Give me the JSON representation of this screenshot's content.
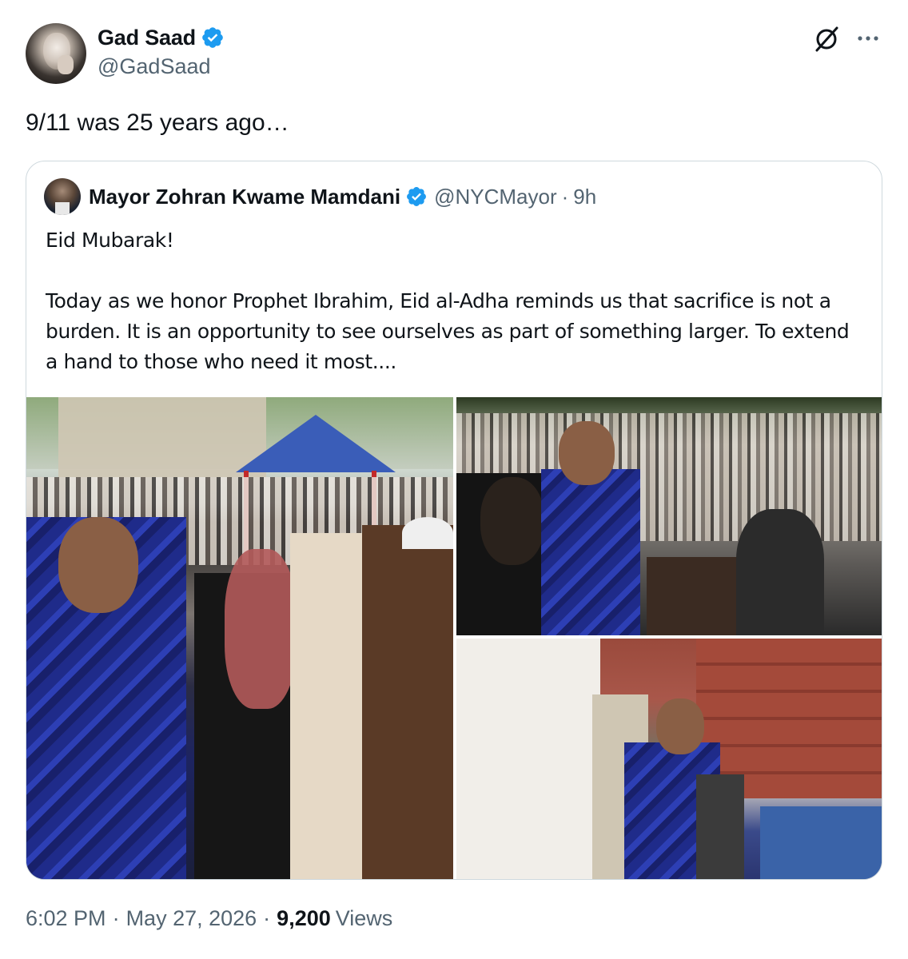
{
  "author": {
    "display_name": "Gad Saad",
    "handle": "@GadSaad",
    "verified_icon": "verified-badge-icon"
  },
  "actions": {
    "grok_icon": "grok-icon",
    "more_icon": "more-options-icon"
  },
  "tweet": {
    "text": "9/11 was 25 years ago…"
  },
  "quote": {
    "display_name": "Mayor Zohran Kwame Mamdani",
    "handle": "@NYCMayor",
    "separator": "·",
    "time": "9h",
    "paragraphs": [
      "Eid Mubarak!",
      "Today as we honor Prophet Ibrahim, Eid al-Adha reminds us that sacrifice is not a burden. It is an opportunity to see ourselves as part of something larger. To extend a hand to those who need it most...."
    ]
  },
  "footer": {
    "time": "6:02 PM",
    "separator": "·",
    "date": "May 27, 2026",
    "views_count": "9,200",
    "views_label": "Views"
  },
  "colors": {
    "text_primary": "#0f1419",
    "text_secondary": "#536471",
    "verified_blue": "#1d9bf0",
    "border": "#cfd9de"
  }
}
